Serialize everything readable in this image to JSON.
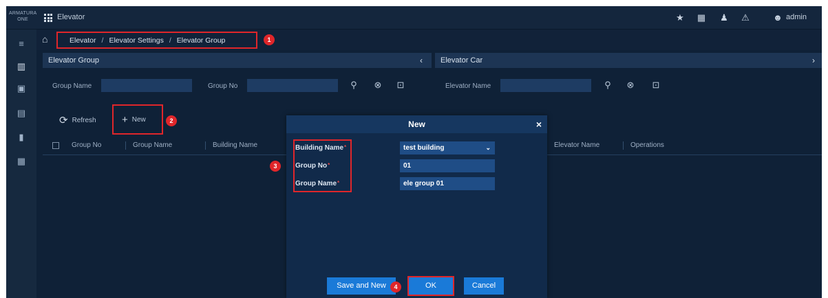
{
  "header": {
    "logo_line1": "ARMATURA",
    "logo_line2": "ONE",
    "app_title": "Elevator",
    "icons": [
      "pin-icon",
      "calendar-icon",
      "bell-icon",
      "alarm-icon",
      "user-icon"
    ],
    "user_name": "admin"
  },
  "sidebar": {
    "icons": [
      "collapse-menu-icon",
      "elevator-icon",
      "monitor-icon",
      "report-icon",
      "device-icon",
      "grid-report-icon"
    ]
  },
  "breadcrumb": {
    "items": [
      "Elevator",
      "Elevator Settings",
      "Elevator Group"
    ],
    "separator": "/"
  },
  "left_panel": {
    "title": "Elevator Group",
    "collapse_arrow": "‹",
    "filters": {
      "group_name_label": "Group Name",
      "group_no_label": "Group No"
    },
    "toolbar": {
      "refresh_label": "Refresh",
      "new_label": "New"
    },
    "columns": [
      "Group No",
      "Group Name",
      "Building Name"
    ]
  },
  "right_panel": {
    "title": "Elevator Car",
    "expand_arrow": "›",
    "filters": {
      "elevator_name_label": "Elevator Name"
    },
    "columns": [
      "Elevator Name",
      "Operations"
    ]
  },
  "modal": {
    "title": "New",
    "close_glyph": "×",
    "fields": [
      {
        "label": "Building Name",
        "value": "test building",
        "type": "select"
      },
      {
        "label": "Group No",
        "value": "01",
        "type": "text"
      },
      {
        "label": "Group Name",
        "value": "ele group 01",
        "type": "text"
      }
    ],
    "required_mark": "*",
    "buttons": {
      "save_and_new": "Save and New",
      "ok": "OK",
      "cancel": "Cancel"
    }
  },
  "annotations": {
    "step1": "1",
    "step2": "2",
    "step3": "3",
    "step4": "4"
  },
  "colors": {
    "background": "#0f2137",
    "panel_header": "#1d3554",
    "input": "#1e3c63",
    "modal": "#112a4a",
    "button_blue": "#1a7ad8",
    "highlight_red": "#e0262a"
  }
}
